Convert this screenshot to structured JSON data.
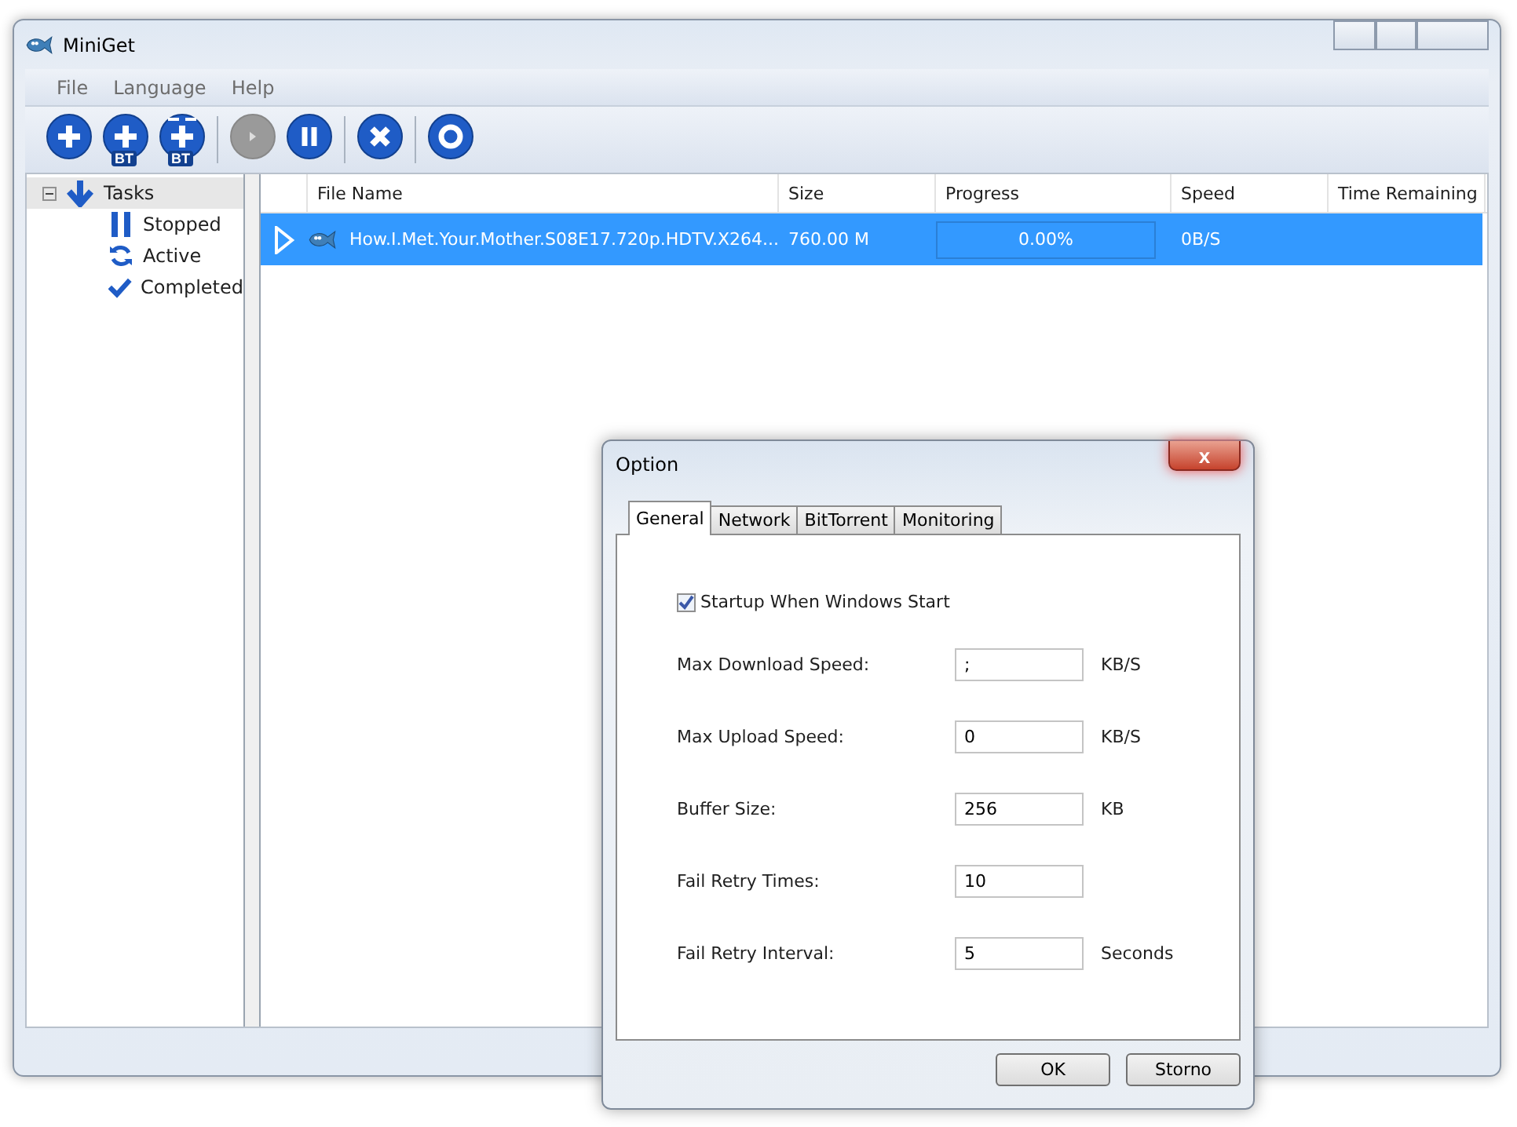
{
  "window": {
    "title": "MiniGet"
  },
  "menu": [
    "File",
    "Language",
    "Help"
  ],
  "toolbar": [
    {
      "kind": "add",
      "disabled": false
    },
    {
      "kind": "add",
      "badge": "BT",
      "disabled": false
    },
    {
      "kind": "add-search",
      "badge": "BT",
      "disabled": false
    },
    {
      "kind": "play",
      "disabled": true
    },
    {
      "kind": "pause",
      "disabled": false
    },
    {
      "kind": "delete",
      "disabled": false
    },
    {
      "kind": "settings",
      "disabled": false
    }
  ],
  "tree": [
    {
      "label": "Tasks",
      "kind": "download",
      "expanded": true,
      "selected": true,
      "children": [
        {
          "label": "Stopped",
          "kind": "pause",
          "selected": false
        },
        {
          "label": "Active",
          "kind": "refresh",
          "selected": false
        },
        {
          "label": "Completed",
          "kind": "check",
          "selected": false
        }
      ]
    }
  ],
  "table": {
    "columns": [
      "File Name",
      "Size",
      "Progress",
      "Speed",
      "Time Remaining"
    ],
    "rows": [
      {
        "file_name": "How.I.Met.Your.Mother.S08E17.720p.HDTV.X264...",
        "size": "760.00 M",
        "progress": "0.00%",
        "level": 0,
        "speed": "0B/S",
        "selected": true
      }
    ]
  },
  "dialog": {
    "title": "Option",
    "close": "x",
    "tabs": [
      {
        "label": "General",
        "selected": true
      },
      {
        "label": "Network",
        "selected": false
      },
      {
        "label": "BitTorrent",
        "selected": false
      },
      {
        "label": "Monitoring",
        "selected": false
      }
    ],
    "checkbox": {
      "label": "Startup When Windows Start",
      "checked": true
    },
    "fields": [
      {
        "label": "Max Download Speed:",
        "value": ";",
        "unit": "KB/S"
      },
      {
        "label": "Max Upload Speed:",
        "value": "0",
        "unit": "KB/S"
      },
      {
        "label": "Buffer Size:",
        "value": "256",
        "unit": "KB"
      },
      {
        "label": "Fail Retry Times:",
        "value": "10"
      },
      {
        "label": "Fail Retry Interval:",
        "value": "5",
        "unit": "Seconds"
      }
    ],
    "buttons": [
      "OK",
      "Storno"
    ]
  }
}
